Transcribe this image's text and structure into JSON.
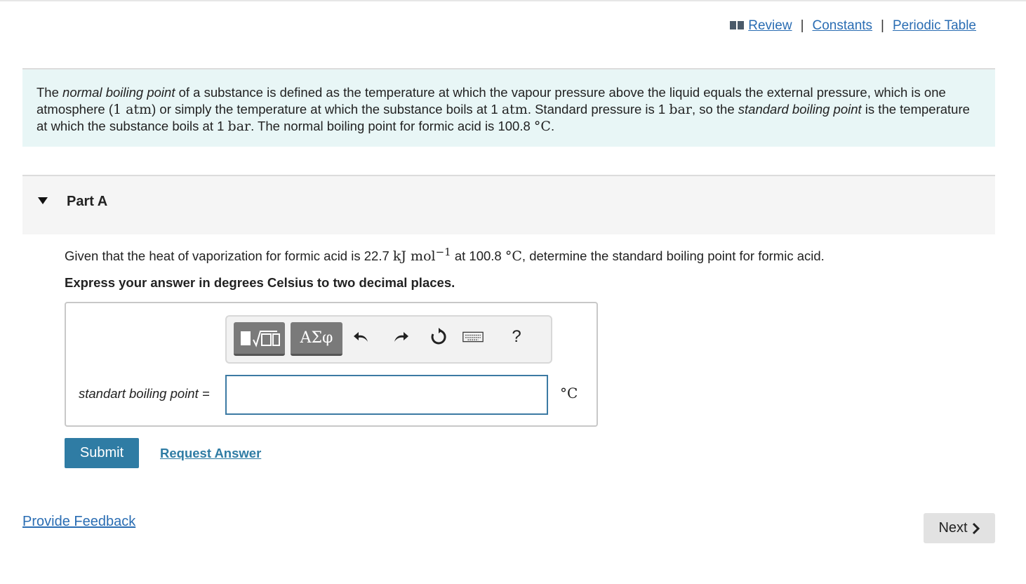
{
  "header": {
    "links": [
      "Review",
      "Constants",
      "Periodic Table"
    ]
  },
  "intro": {
    "t1": "The ",
    "i1": "normal boiling point",
    "t2": " of a substance is defined as the temperature at which the vapour pressure above the liquid equals the external pressure, which is one atmosphere (",
    "m1": "1 atm",
    "t3": ") or simply the temperature at which the substance boils at 1 ",
    "m2": "atm",
    "t4": ". Standard pressure is 1 ",
    "m3": "bar",
    "t5": ", so the ",
    "i2": "standard boiling point",
    "t6": " is the temperature at which the substance boils at 1 ",
    "m4": "bar",
    "t7": ". The normal boiling point for formic acid is 100.8 ",
    "m5": "°C",
    "t8": "."
  },
  "part": {
    "title": "Part A"
  },
  "question": {
    "q1": "Given that the heat of vaporization for formic acid is 22.7 ",
    "qm1": "kJ mol",
    "qsup": "−1",
    "q2": " at 100.8 ",
    "qm2": "°C",
    "q3": ", determine the standard boiling point for formic acid.",
    "instruction": "Express your answer in degrees Celsius to two decimal places."
  },
  "toolbar": {
    "greek_label": "ΑΣφ",
    "help_label": "?"
  },
  "answer": {
    "label": "standart boiling point =",
    "value": "",
    "unit": "°C"
  },
  "actions": {
    "submit": "Submit",
    "request": "Request Answer",
    "feedback": "Provide Feedback",
    "next": "Next"
  }
}
